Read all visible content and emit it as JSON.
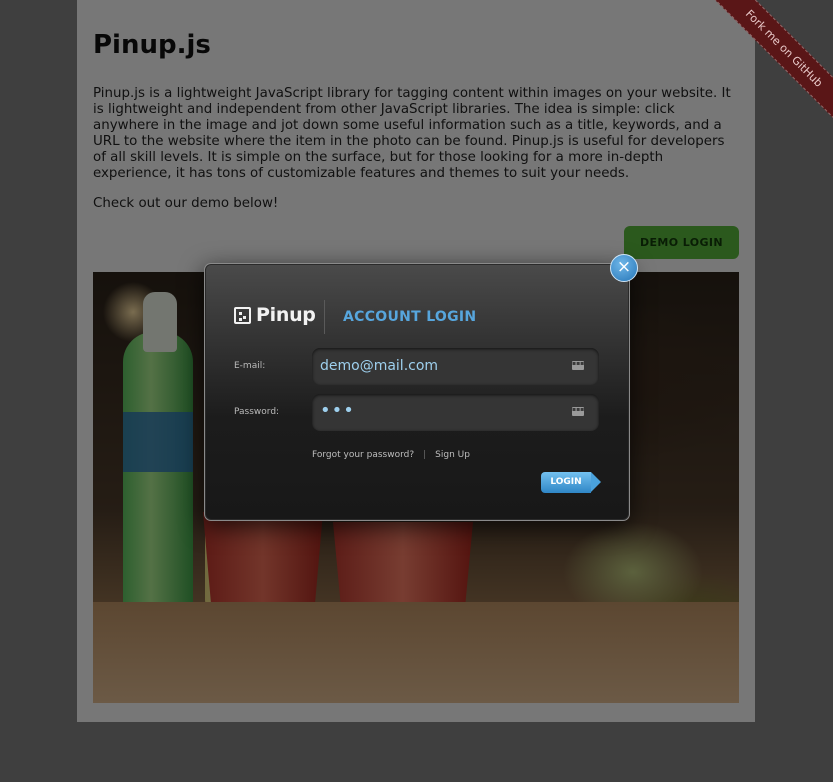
{
  "page": {
    "title": "Pinup.js",
    "intro": "Pinup.js is a lightweight JavaScript library for tagging content within images on your website. It is lightweight and independent from other JavaScript libraries. The idea is simple: click anywhere in the image and jot down some useful information such as a title, keywords, and a URL to the website where the item in the photo can be found. Pinup.js is useful for developers of all skill levels. It is simple on the surface, but for those looking for a more in-depth experience, it has tons of customizable features and themes to suit your needs.",
    "demo_line": "Check out our demo below!",
    "demo_button": "DEMO LOGIN",
    "ribbon": "Fork me on GitHub"
  },
  "modal": {
    "brand": "Pinup",
    "title": "ACCOUNT LOGIN",
    "email_label": "E-mail:",
    "email_value": "demo@mail.com",
    "password_label": "Password:",
    "password_value": "•••",
    "forgot_link": "Forgot your password?",
    "separator": "|",
    "signup_link": "Sign Up",
    "login_button": "LOGIN",
    "close_glyph": "×",
    "keyboard_glyph": "▪▪▪"
  },
  "colors": {
    "accent": "#57a6dd",
    "demo_button": "#57b33a",
    "ribbon": "#5a1617"
  },
  "icons": [
    "close-icon",
    "keyboard-icon",
    "pinup-logo-icon"
  ]
}
